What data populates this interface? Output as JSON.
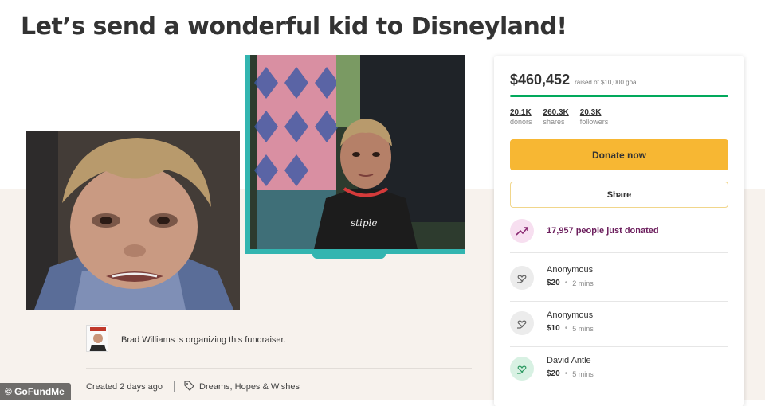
{
  "campaign": {
    "title": "Let’s send a wonderful kid to Disneyland!"
  },
  "organizer": {
    "text": "Brad Williams is organizing this fundraiser."
  },
  "meta": {
    "created": "Created 2 days ago",
    "category": "Dreams, Hopes & Wishes"
  },
  "card": {
    "raised_amount": "$460,452",
    "raised_goal": "raised of $10,000 goal",
    "progress_fraction": 1.0,
    "stats": [
      {
        "value": "20.1K",
        "label": "donors"
      },
      {
        "value": "260.3K",
        "label": "shares"
      },
      {
        "value": "20.3K",
        "label": "followers"
      }
    ],
    "donate_label": "Donate now",
    "share_label": "Share",
    "trend_text": "17,957 people just donated"
  },
  "donations": [
    {
      "name": "Anonymous",
      "amount": "$20",
      "time": "2 mins",
      "icon": "heart-hand-icon"
    },
    {
      "name": "Anonymous",
      "amount": "$10",
      "time": "5 mins",
      "icon": "heart-hand-icon"
    },
    {
      "name": "David Antle",
      "amount": "$20",
      "time": "5 mins",
      "icon": "heart-hand-icon"
    }
  ],
  "watermark": "© GoFundMe",
  "colors": {
    "accent_green": "#02a95c",
    "donate_yellow": "#f7b733",
    "photo_frame_teal": "#33b5b0",
    "trend_purple": "#6b1d5c"
  }
}
